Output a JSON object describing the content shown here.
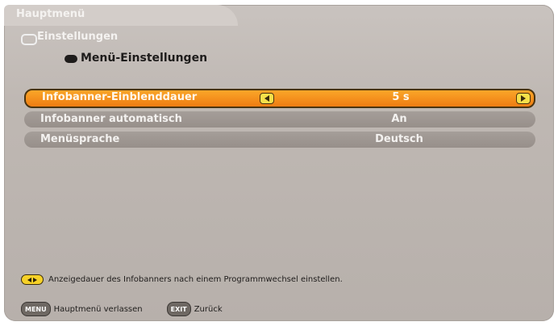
{
  "breadcrumb": {
    "level1": "Hauptmenü",
    "level2": "Einstellungen",
    "level3": "Menü-Einstellungen"
  },
  "settings": [
    {
      "label": "Infobanner-Einblenddauer",
      "value": "5 s",
      "selected": true
    },
    {
      "label": "Infobanner automatisch",
      "value": "An",
      "selected": false
    },
    {
      "label": "Menüsprache",
      "value": "Deutsch",
      "selected": false
    }
  ],
  "hint": {
    "icon": "left-right-arrows-icon",
    "text": "Anzeigedauer des Infobanners nach einem Programmwechsel einstellen."
  },
  "footer": [
    {
      "key": "MENU",
      "label": "Hauptmenü verlassen"
    },
    {
      "key": "EXIT",
      "label": "Zurück"
    }
  ],
  "colors": {
    "panel": "#bfb8b3",
    "row": "#9d9691",
    "selected_row": "#f39018",
    "accent_button": "#f6e04a"
  }
}
